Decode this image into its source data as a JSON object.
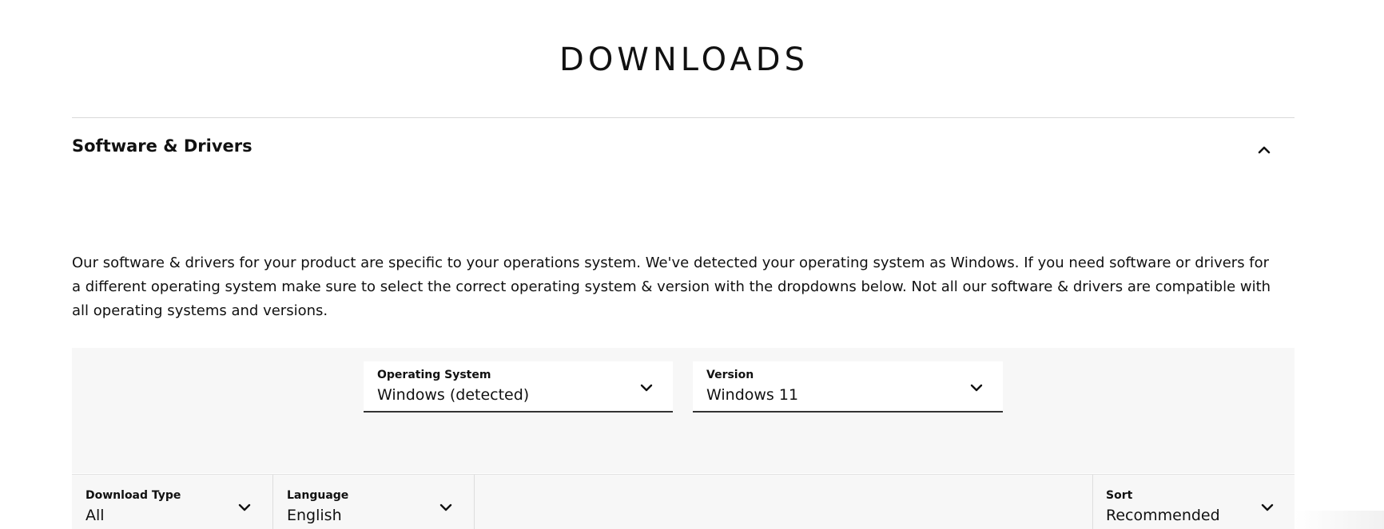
{
  "page": {
    "title": "DOWNLOADS"
  },
  "section": {
    "title": "Software & Drivers",
    "expanded": true,
    "toggle_icon": "chevron-up-icon"
  },
  "description": "Our software & drivers for your product are specific to your operations system. We've detected your operating system as Windows. If you need software or drivers for a different operating system make sure to select the correct operating system & version with the dropdowns below. Not all our software & drivers are compatible with all operating systems and versions.",
  "selectors": {
    "operating_system": {
      "label": "Operating System",
      "value": "Windows (detected)",
      "icon": "chevron-down-icon"
    },
    "version": {
      "label": "Version",
      "value": "Windows 11",
      "icon": "chevron-down-icon"
    }
  },
  "filters": {
    "download_type": {
      "label": "Download Type",
      "value": "All",
      "icon": "chevron-down-icon"
    },
    "language": {
      "label": "Language",
      "value": "English",
      "icon": "chevron-down-icon"
    },
    "sort": {
      "label": "Sort",
      "value": "Recommended",
      "icon": "chevron-down-icon"
    }
  },
  "colors": {
    "text": "#111111",
    "panel_background": "#f7f7f7",
    "divider": "#d9d9d9",
    "select_underline": "#333333"
  }
}
